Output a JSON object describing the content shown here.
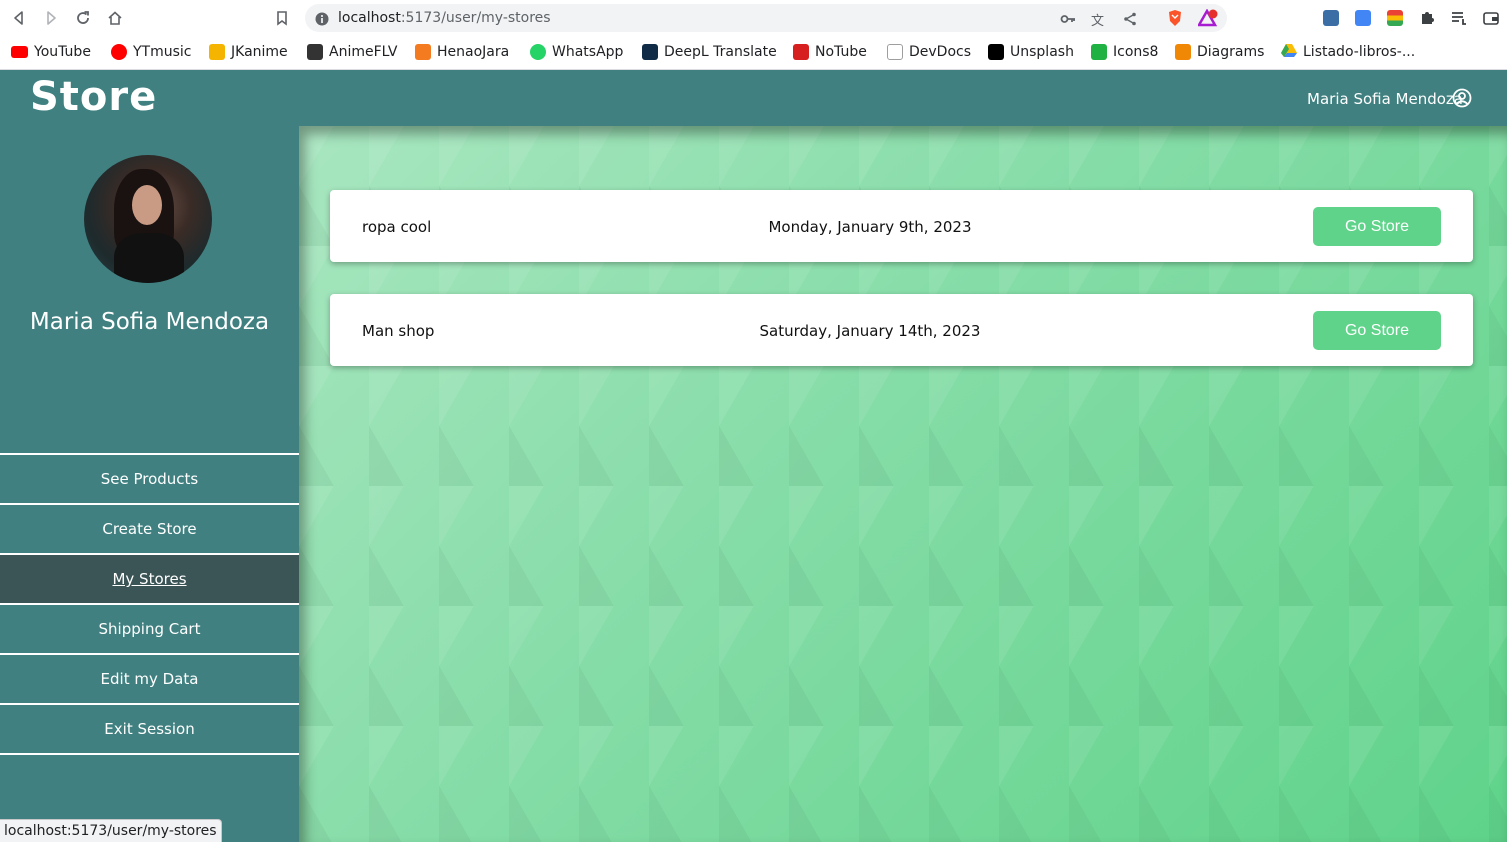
{
  "browser": {
    "url_host": "localhost",
    "url_path": ":5173/user/my-stores",
    "bookmarks": [
      {
        "label": "YouTube",
        "color": "#ff0000"
      },
      {
        "label": "YTmusic",
        "color": "#ff0000"
      },
      {
        "label": "JKanime",
        "color": "#f4b400"
      },
      {
        "label": "AnimeFLV",
        "color": "#333333"
      },
      {
        "label": "HenaoJara",
        "color": "#f47b20"
      },
      {
        "label": "WhatsApp",
        "color": "#25d366"
      },
      {
        "label": "DeepL Translate",
        "color": "#0f2b46"
      },
      {
        "label": "NoTube",
        "color": "#d61f1f"
      },
      {
        "label": "DevDocs",
        "color": "#9e9e9e"
      },
      {
        "label": "Unsplash",
        "color": "#000000"
      },
      {
        "label": "Icons8",
        "color": "#1fb141"
      },
      {
        "label": "Diagrams",
        "color": "#f08705"
      },
      {
        "label": "Listado-libros-...",
        "color": "#4285f4"
      }
    ],
    "status_url": "localhost:5173/user/my-stores"
  },
  "header": {
    "logo": "Store",
    "user_name": "Maria Sofia  Mendoza"
  },
  "sidebar": {
    "user_name": "Maria Sofia  Mendoza",
    "menu": [
      {
        "label": "See Products"
      },
      {
        "label": "Create Store"
      },
      {
        "label": "My Stores"
      },
      {
        "label": "Shipping Cart"
      },
      {
        "label": "Edit my  Data"
      },
      {
        "label": "Exit Session"
      }
    ]
  },
  "stores": [
    {
      "name": "ropa cool",
      "date": "Monday, January 9th, 2023",
      "button": "Go Store"
    },
    {
      "name": "Man shop",
      "date": "Saturday, January 14th, 2023",
      "button": "Go Store"
    }
  ],
  "colors": {
    "primary": "#408080",
    "active_menu": "#3b5456",
    "accent_button": "#5fd38a"
  }
}
